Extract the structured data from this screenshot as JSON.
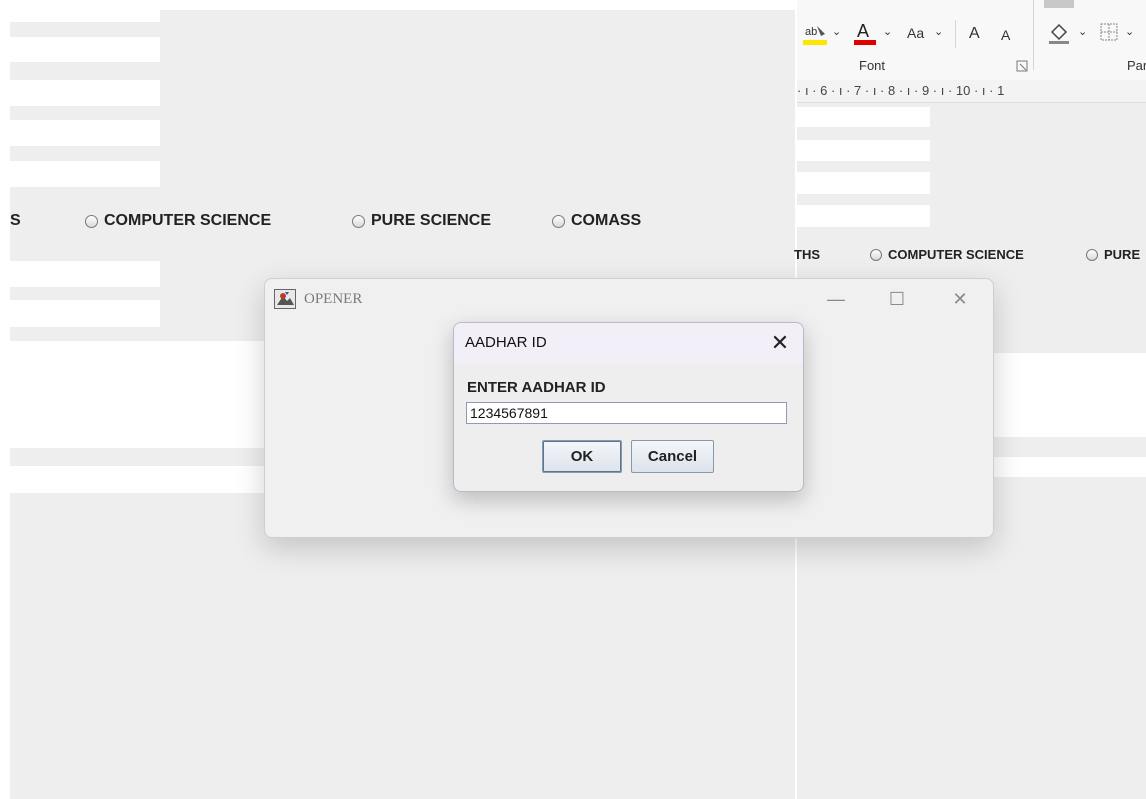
{
  "background_left": {
    "radio_options": [
      "S",
      "COMPUTER SCIENCE",
      "PURE SCIENCE",
      "COMASS"
    ]
  },
  "background_right": {
    "ribbon": {
      "font_group_label": "Font",
      "paragraph_group_label": "Parag",
      "font_case_label": "Aa",
      "grow_font": "A",
      "shrink_font": "A"
    },
    "ruler_text": "· ı · 6 · ı · 7 · ı · 8 · ı · 9 · ı · 10 · ı · 1",
    "radio_options": [
      "THS",
      "COMPUTER SCIENCE",
      "PURE"
    ]
  },
  "opener_window": {
    "title": "OPENER",
    "minimize_glyph": "—",
    "maximize_glyph": "☐",
    "close_glyph": "✕"
  },
  "dialog": {
    "title": "AADHAR ID",
    "close_glyph": "✕",
    "prompt": "ENTER AADHAR ID",
    "input_value": "1234567891",
    "ok_label": "OK",
    "cancel_label": "Cancel"
  },
  "colors": {
    "window_bg": "#eeeeee",
    "dialog_titlebar": "#f3eff8",
    "button_border": "#8899aa"
  }
}
